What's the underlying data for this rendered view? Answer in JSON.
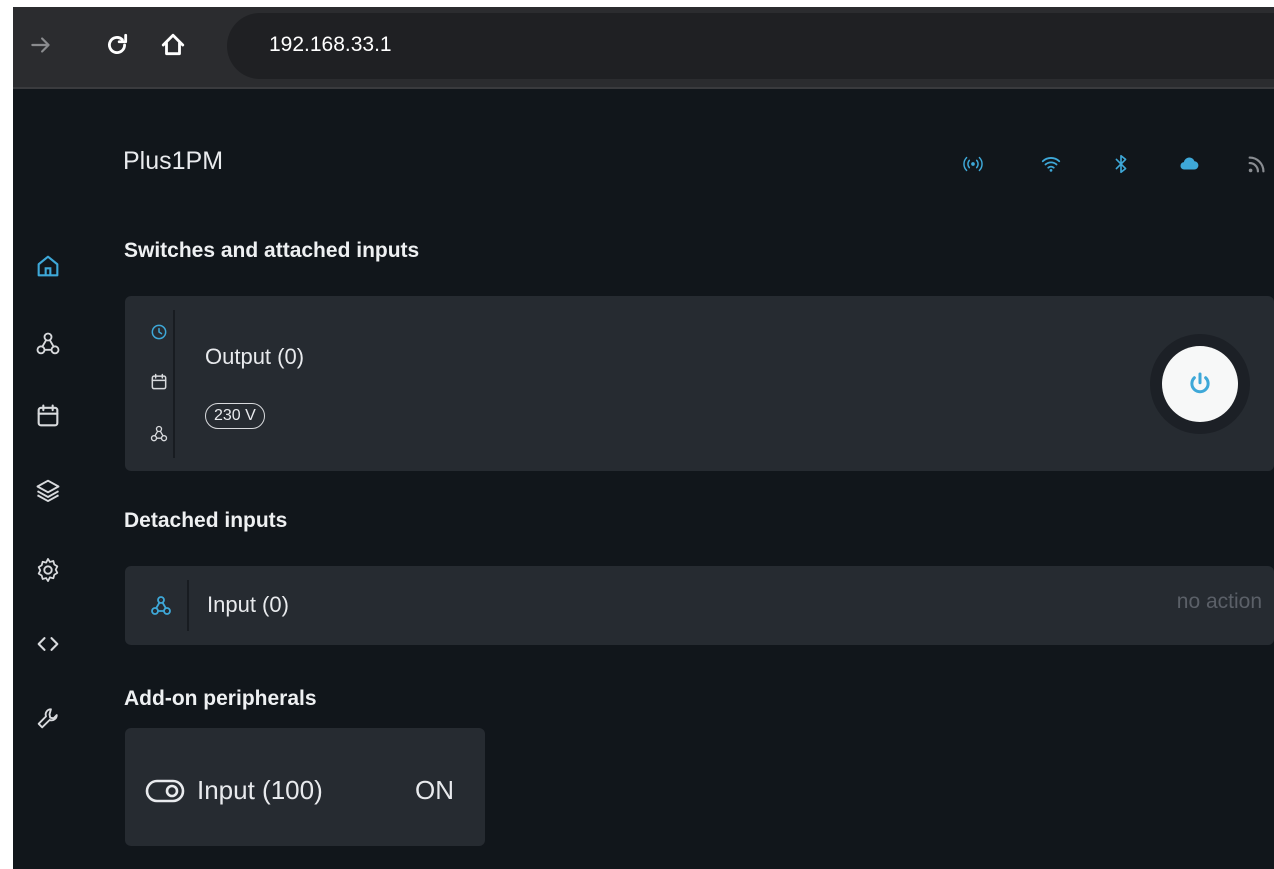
{
  "browser": {
    "url": "192.168.33.1"
  },
  "header": {
    "device_name": "Plus1PM",
    "status_icons": [
      "broadcast-icon",
      "wifi-icon",
      "bluetooth-icon",
      "cloud-icon",
      "rss-icon"
    ]
  },
  "sidebar": {
    "items": [
      "home-icon",
      "webhook-icon",
      "calendar-icon",
      "layers-icon",
      "gear-icon",
      "code-icon",
      "wrench-icon"
    ]
  },
  "sections": {
    "switches_title": "Switches and attached inputs",
    "detached_title": "Detached inputs",
    "addon_title": "Add-on peripherals"
  },
  "switch": {
    "name": "Output (0)",
    "voltage": "230 V"
  },
  "detached_input": {
    "name": "Input (0)",
    "action": "no action"
  },
  "addon": {
    "name": "Input (100)",
    "state": "ON"
  },
  "colors": {
    "accent": "#3ea8d8",
    "background": "#11161b",
    "card": "#262b31"
  }
}
